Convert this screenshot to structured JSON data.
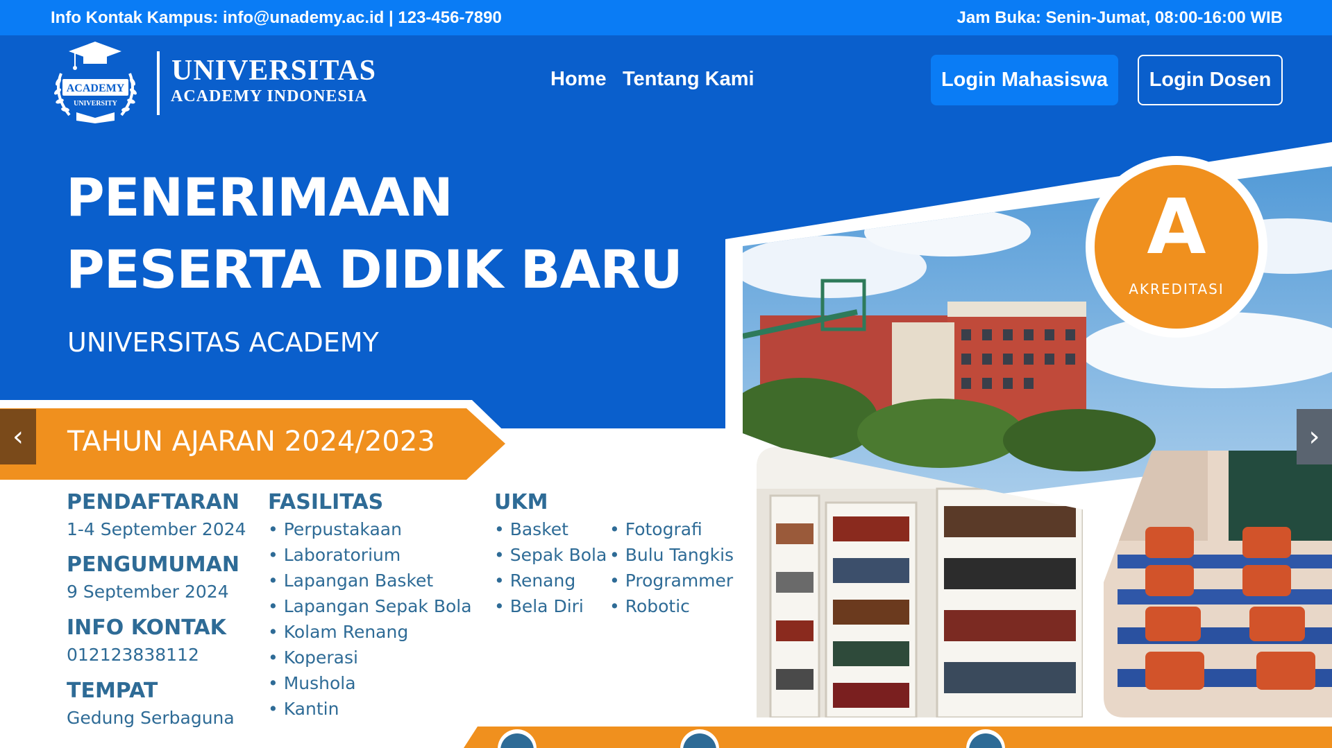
{
  "topbar": {
    "contact": "Info Kontak Kampus: info@unademy.ac.id | 123-456-7890",
    "hours": "Jam Buka: Senin-Jumat, 08:00-16:00 WIB"
  },
  "logo": {
    "emblem_top": "ACADEMY",
    "emblem_bottom": "UNIVERSITY",
    "title": "UNIVERSITAS",
    "subtitle": "ACADEMY INDONESIA"
  },
  "nav": {
    "home": "Home",
    "about": "Tentang Kami"
  },
  "buttons": {
    "login_mahasiswa": "Login Mahasiswa",
    "login_dosen": "Login Dosen"
  },
  "hero": {
    "line1": "PENERIMAAN",
    "line2": "PESERTA DIDIK BARU",
    "subtitle": "UNIVERSITAS ACADEMY",
    "ribbon": "TAHUN AJARAN 2024/2023"
  },
  "badge": {
    "grade": "A",
    "label": "AKREDITASI"
  },
  "carousel": {
    "prev": "‹",
    "next": "›"
  },
  "info": {
    "pendaftaran_label": "PENDAFTARAN",
    "pendaftaran_value": "1-4 September 2024",
    "pengumuman_label": "PENGUMUMAN",
    "pengumuman_value": "9 September 2024",
    "kontak_label": "INFO KONTAK",
    "kontak_value": "012123838112",
    "tempat_label": "TEMPAT",
    "tempat_value": "Gedung Serbaguna"
  },
  "fasilitas": {
    "label": "FASILITAS",
    "items": [
      "Perpustakaan",
      "Laboratorium",
      "Lapangan Basket",
      "Lapangan Sepak Bola",
      "Kolam Renang",
      "Koperasi",
      "Mushola",
      "Kantin"
    ]
  },
  "ukm": {
    "label": "UKM",
    "col1": [
      "Basket",
      "Sepak Bola",
      "Renang",
      "Bela Diri"
    ],
    "col2": [
      "Fotografi",
      "Bulu Tangkis",
      "Programmer",
      "Robotic"
    ]
  },
  "colors": {
    "topbar": "#0a7cf5",
    "hero": "#0a5fcc",
    "orange": "#f0901e",
    "text_blue": "#2e6b96"
  }
}
